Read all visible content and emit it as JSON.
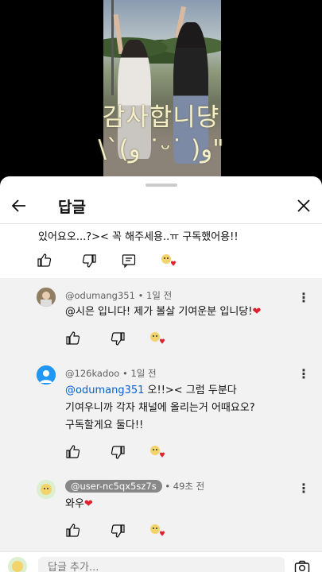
{
  "video": {
    "caption_line1": "감사합니댱",
    "caption_line2": "\\`(و ˙ᵕ˙ )و\""
  },
  "sheet": {
    "title": "답글"
  },
  "parent_comment": {
    "text": "있어요오...?><  꼭 해주세용..ㅠ 구독했어용!!"
  },
  "replies": [
    {
      "author": "@odumang351",
      "time": "1일 전",
      "text": "@시은 입니다! 제가 볼살 기여운분 입니당!",
      "heart": "❤"
    },
    {
      "author": "@126kadoo",
      "time": "1일 전",
      "mention": "@odumang351",
      "line1_rest": " 오!!>< 그럼 두분다",
      "line2": "기여우니까 각자 채널에 올리는거 어때요오?",
      "line3": "구독할게요 둘다!!"
    },
    {
      "author": "@user-nc5qx5sz7s",
      "time": "49초 전",
      "text": "와우",
      "heart": "❤"
    }
  ],
  "input": {
    "placeholder": "답글 추가..."
  },
  "colors": {
    "accent": "#065fd4",
    "heart": "#e0202f"
  }
}
